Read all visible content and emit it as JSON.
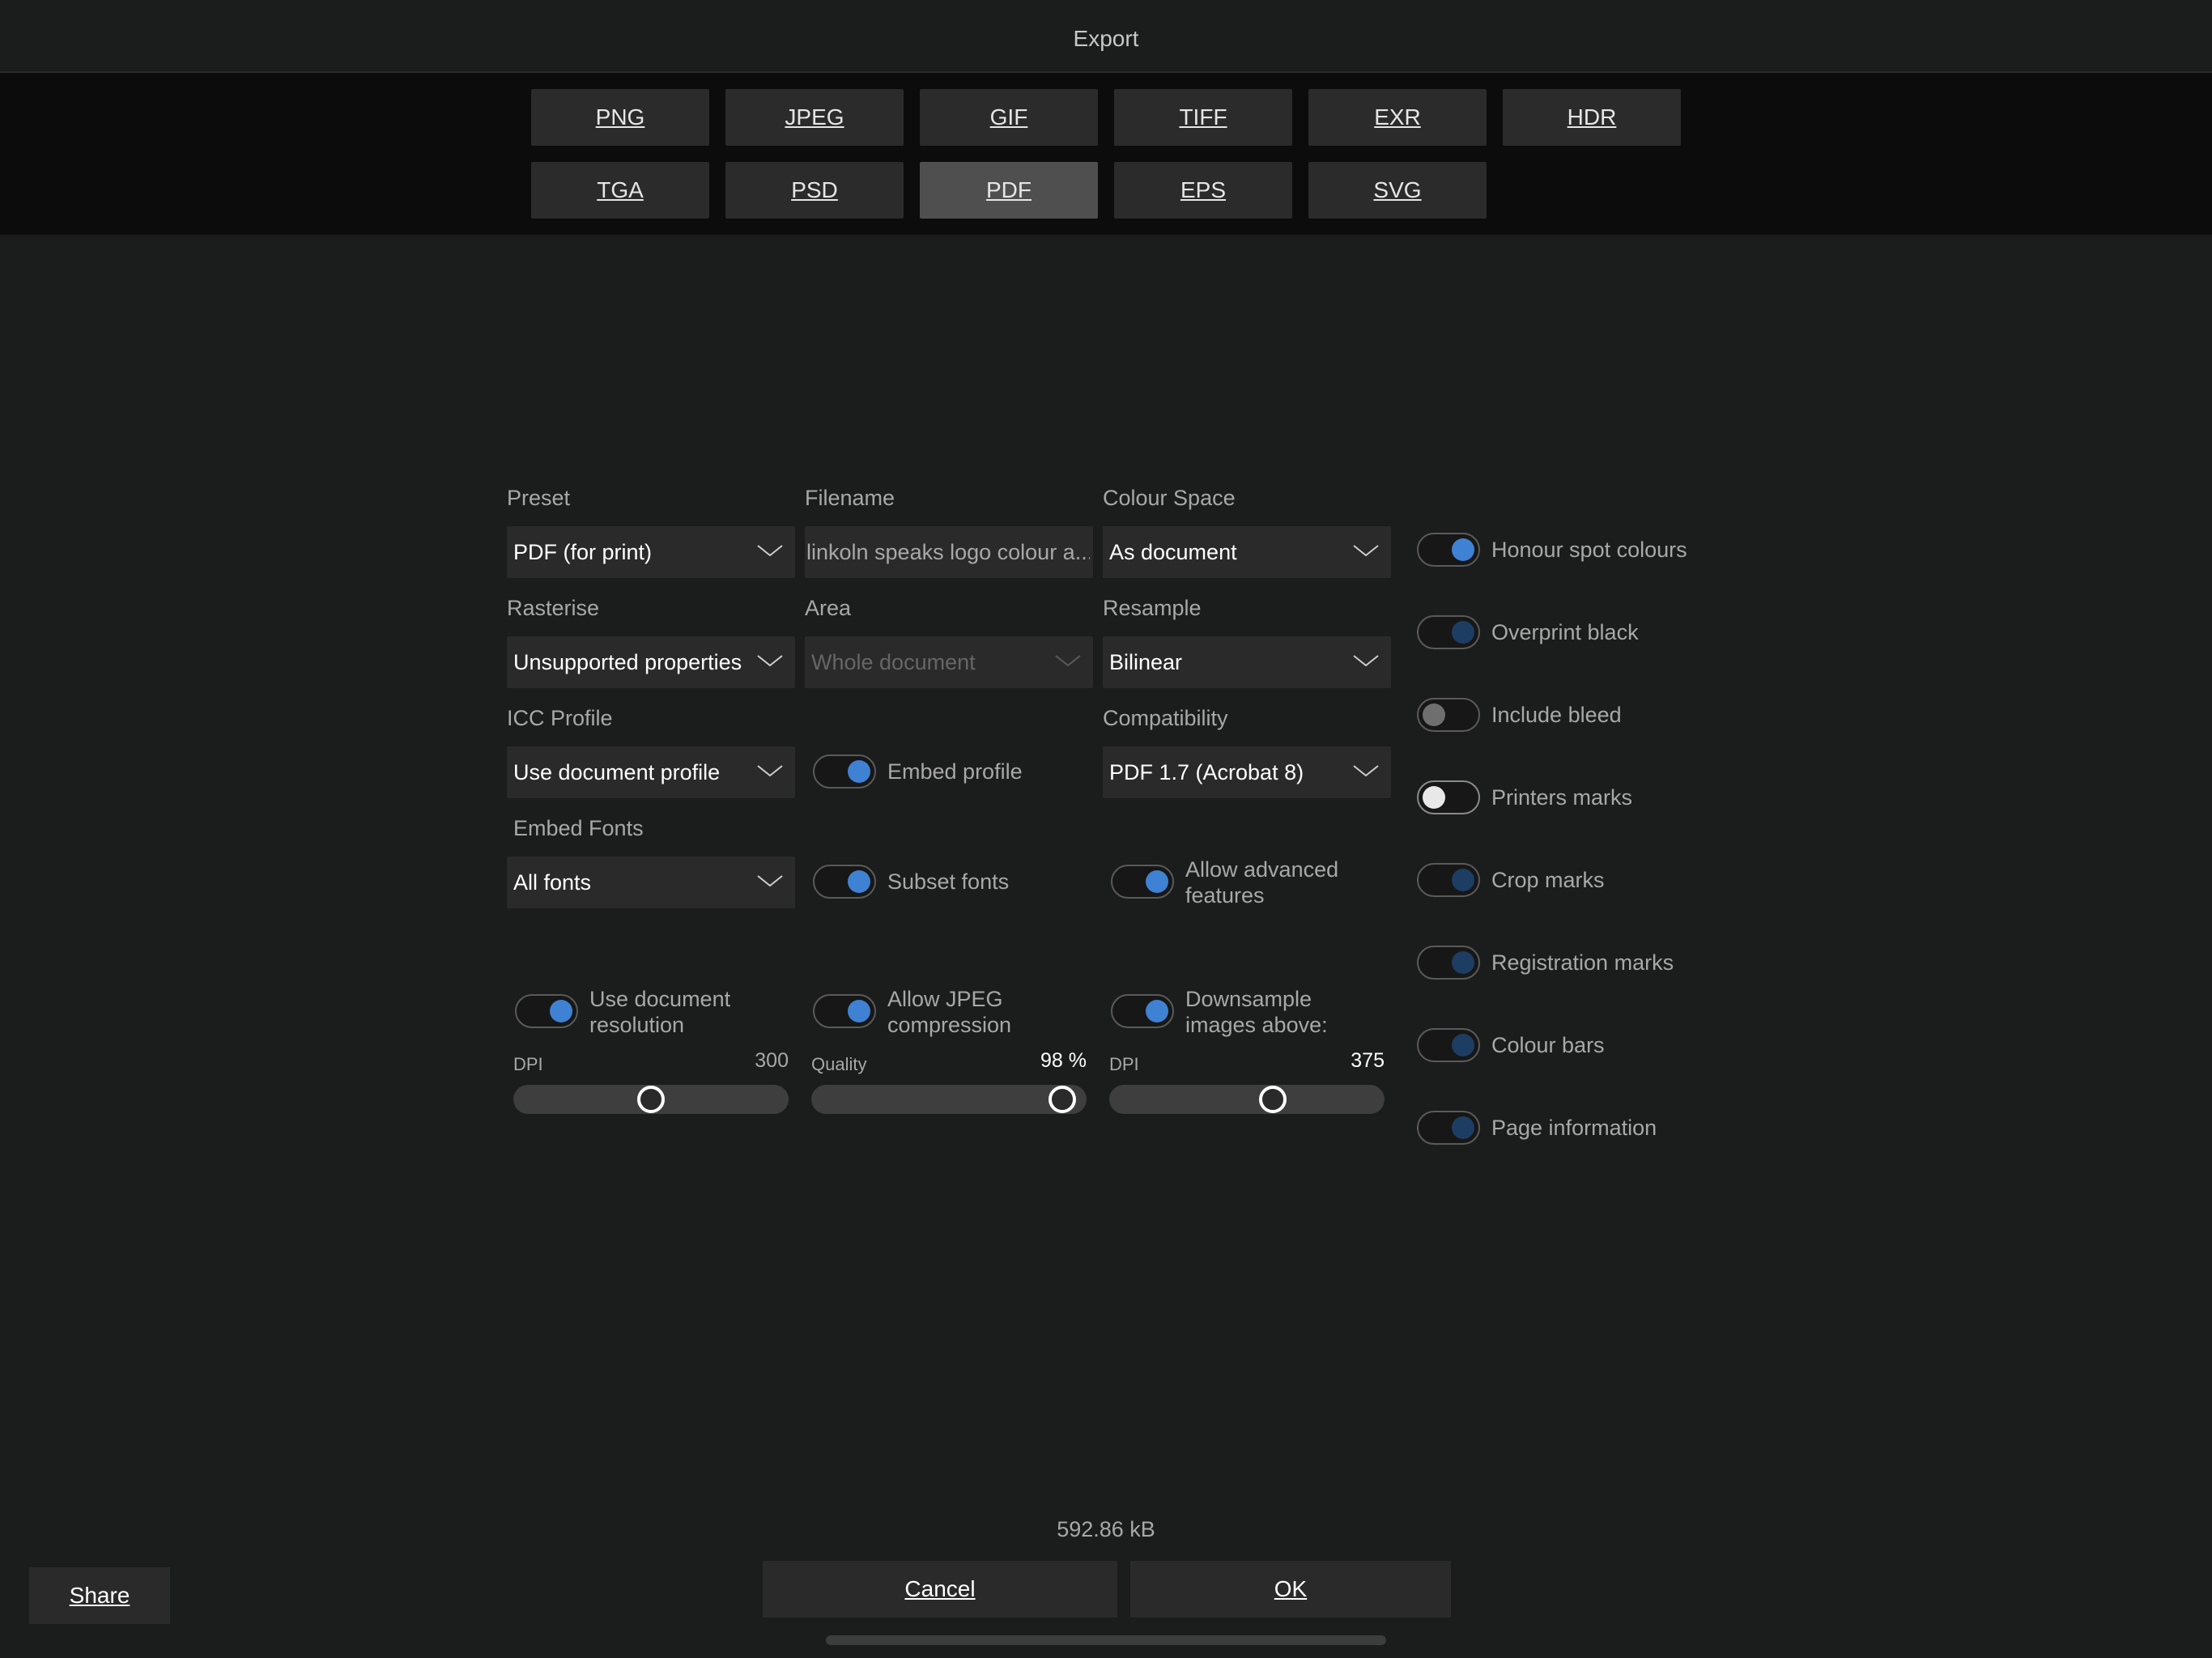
{
  "window": {
    "title": "Export"
  },
  "formats": [
    "PNG",
    "JPEG",
    "GIF",
    "TIFF",
    "EXR",
    "HDR",
    "TGA",
    "PSD",
    "PDF",
    "EPS",
    "SVG"
  ],
  "selected_format": "PDF",
  "fields": {
    "preset": {
      "label": "Preset",
      "value": "PDF (for print)"
    },
    "filename": {
      "label": "Filename",
      "value": "linkoln speaks logo colour a..."
    },
    "colour_space": {
      "label": "Colour Space",
      "value": "As document"
    },
    "rasterise": {
      "label": "Rasterise",
      "value": "Unsupported properties"
    },
    "area": {
      "label": "Area",
      "value": "Whole document"
    },
    "resample": {
      "label": "Resample",
      "value": "Bilinear"
    },
    "icc_profile": {
      "label": "ICC Profile",
      "value": "Use document profile"
    },
    "compatibility": {
      "label": "Compatibility",
      "value": "PDF 1.7 (Acrobat 8)"
    },
    "embed_fonts": {
      "label": "Embed Fonts",
      "value": "All fonts"
    }
  },
  "toggles": {
    "embed_profile": {
      "label": "Embed profile",
      "on": true
    },
    "subset_fonts": {
      "label": "Subset fonts",
      "on": true
    },
    "allow_advanced": {
      "label_line1": "Allow advanced",
      "label_line2": "features",
      "on": true
    },
    "use_doc_resolution": {
      "label_line1": "Use document",
      "label_line2": "resolution",
      "on": true
    },
    "allow_jpeg": {
      "label_line1": "Allow JPEG",
      "label_line2": "compression",
      "on": true
    },
    "downsample": {
      "label_line1": "Downsample",
      "label_line2": "images above:",
      "on": true
    },
    "honour_spot": {
      "label": "Honour spot colours",
      "on": true
    },
    "overprint_black": {
      "label": "Overprint black",
      "on": true
    },
    "include_bleed": {
      "label": "Include bleed",
      "on": false
    },
    "printers_marks": {
      "label": "Printers marks",
      "on": false
    },
    "crop_marks": {
      "label": "Crop marks",
      "on": true
    },
    "registration_marks": {
      "label": "Registration marks",
      "on": true
    },
    "colour_bars": {
      "label": "Colour bars",
      "on": true
    },
    "page_information": {
      "label": "Page information",
      "on": true
    }
  },
  "sliders": {
    "dpi1": {
      "label": "DPI",
      "value_text": "300",
      "fraction": 0.5
    },
    "quality": {
      "label": "Quality",
      "value_text": "98 %",
      "fraction": 0.98
    },
    "dpi2": {
      "label": "DPI",
      "value_text": "375",
      "fraction": 0.61
    }
  },
  "footer": {
    "file_size": "592.86 kB",
    "cancel_label": "Cancel",
    "ok_label": "OK",
    "share_label": "Share"
  },
  "icons": {
    "dropdown": "chevron-down-icon"
  },
  "colors": {
    "accent": "#3f82d4",
    "background": "#1b1c1c"
  }
}
